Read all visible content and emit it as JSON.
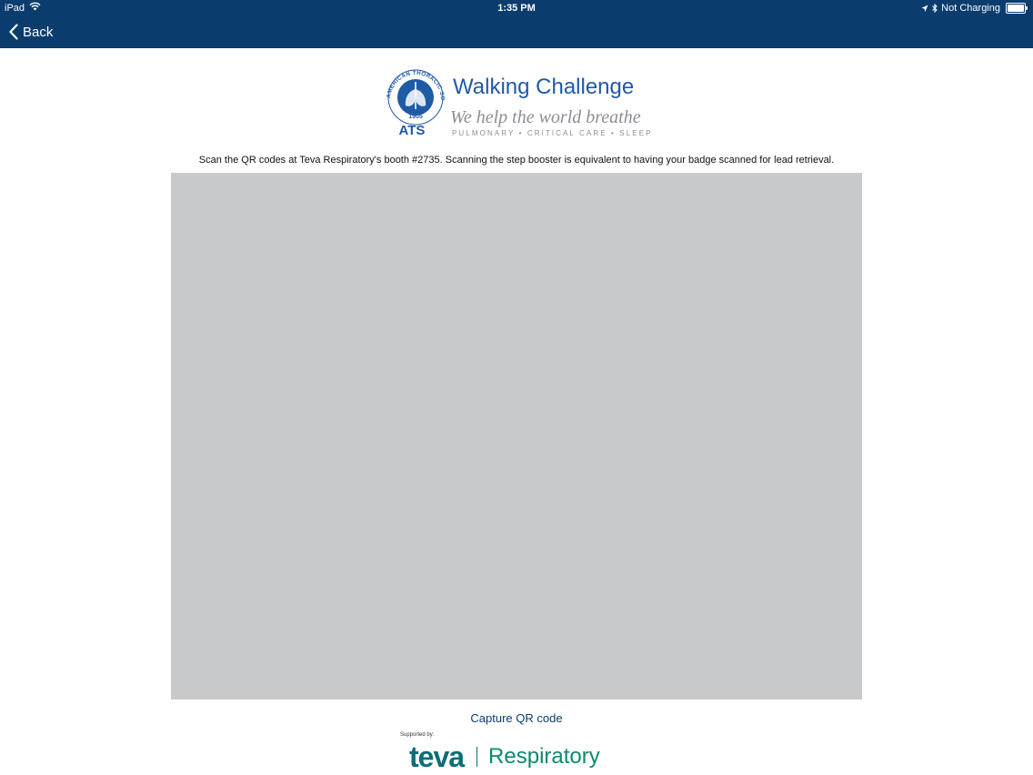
{
  "status_bar": {
    "device": "iPad",
    "time": "1:35 PM",
    "charging": "Not Charging",
    "icons": [
      "wifi-icon",
      "location-icon",
      "bluetooth-icon",
      "battery-icon"
    ]
  },
  "nav": {
    "back_label": "Back"
  },
  "logo": {
    "title": "Walking Challenge",
    "tagline": "We help the world breathe",
    "subtagline": "PULMONARY • CRITICAL CARE • SLEEP",
    "emblem_text": "ATS",
    "emblem_year": "1905",
    "emblem_ring_text": "AMERICAN THORACIC SOCIETY"
  },
  "instructions": "Scan the QR codes at Teva Respiratory's booth #2735. Scanning the step booster is equivalent to having your badge scanned for lead retrieval.",
  "capture_label": "Capture QR code",
  "footer": {
    "supported_by": "Supported by:",
    "sponsor_name": "teva",
    "sponsor_division": "Respiratory"
  },
  "colors": {
    "header_bg": "#0a3c6e",
    "brand_blue": "#1f5aa6",
    "camera_bg": "#c8c9cb",
    "teva_teal": "#0b6e78",
    "teva_green": "#0b8a6e"
  }
}
